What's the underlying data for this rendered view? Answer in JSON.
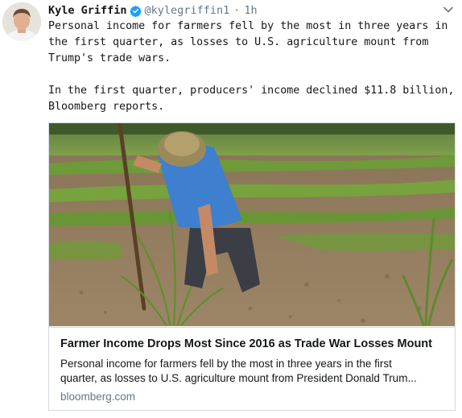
{
  "tweet": {
    "author": {
      "display_name": "Kyle Griffin",
      "verified_icon": "verified-badge-icon",
      "handle": "@kylegriffin1",
      "separator": "·",
      "time": "1h"
    },
    "text": {
      "paragraph1": "Personal income for farmers fell by the most in three years in\nthe first quarter, as losses to U.S. agriculture mount from\nTrump's trade wars.",
      "paragraph2": "In the first quarter, producers' income declined $11.8 billion,\nBloomberg reports."
    },
    "card": {
      "title": "Farmer Income Drops Most Since 2016 as Trade War Losses Mount",
      "description_line1": "Personal income for farmers fell by the most in three years in the first",
      "description_line2": "quarter, as losses to U.S. agriculture mount from President Donald Trum...",
      "domain": "bloomberg.com"
    }
  },
  "colors": {
    "text_primary": "#14171a",
    "text_secondary": "#657786",
    "verified_blue": "#1da1f2",
    "border": "#d5dbe0"
  }
}
